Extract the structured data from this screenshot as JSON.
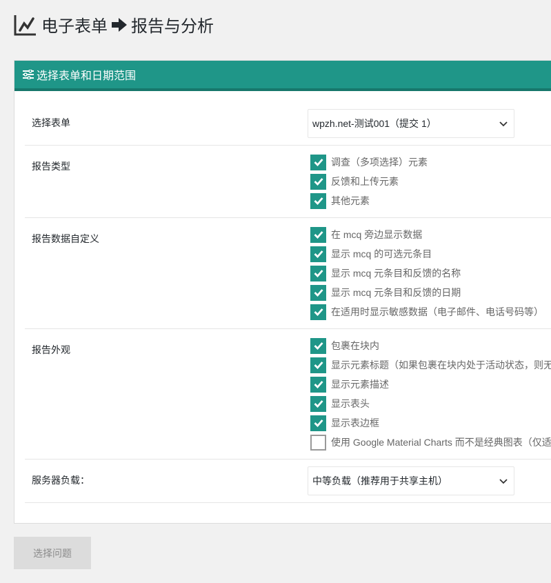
{
  "page": {
    "title_part1": "电子表单",
    "title_part2": "报告与分析"
  },
  "panel": {
    "title": "选择表单和日期范围"
  },
  "form": {
    "select_form": {
      "label": "选择表单",
      "value": "wpzh.net-测试001（提交 1）"
    },
    "report_type": {
      "label": "报告类型",
      "options": [
        {
          "label": "调查（多项选择）元素",
          "checked": true
        },
        {
          "label": "反馈和上传元素",
          "checked": true
        },
        {
          "label": "其他元素",
          "checked": true
        }
      ]
    },
    "customization": {
      "label": "报告数据自定义",
      "options": [
        {
          "label": "在 mcq 旁边显示数据",
          "checked": true
        },
        {
          "label": "显示 mcq 的可选元条目",
          "checked": true
        },
        {
          "label": "显示 mcq 元条目和反馈的名称",
          "checked": true
        },
        {
          "label": "显示 mcq 元条目和反馈的日期",
          "checked": true
        },
        {
          "label": "在适用时显示敏感数据（电子邮件、电话号码等）",
          "checked": true
        }
      ]
    },
    "appearance": {
      "label": "报告外观",
      "options": [
        {
          "label": "包裹在块内",
          "checked": true
        },
        {
          "label": "显示元素标题（如果包裹在块内处于活动状态，则无",
          "checked": true
        },
        {
          "label": "显示元素描述",
          "checked": true
        },
        {
          "label": "显示表头",
          "checked": true
        },
        {
          "label": "显示表边框",
          "checked": true
        },
        {
          "label": "使用 Google Material Charts 而不是经典图表（仅适",
          "checked": false
        }
      ]
    },
    "server_load": {
      "label": "服务器负载：",
      "value": "中等负载（推荐用于共享主机）"
    }
  },
  "actions": {
    "select_questions": "选择问题"
  },
  "colors": {
    "accent": "#1f9688"
  }
}
